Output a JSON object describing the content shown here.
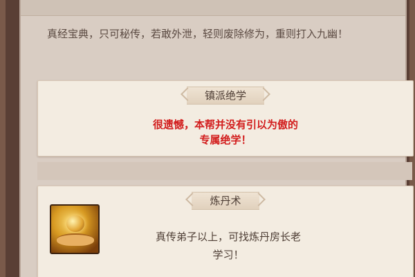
{
  "warning_text": "真经宝典，只可秘传，若敢外泄，轻则废除修为，重则打入九幽！",
  "cards": [
    {
      "title": "镇派绝学",
      "lines": [
        "很遗憾，本帮并没有引以为傲的",
        "专属绝学！"
      ],
      "text_color": "#d21c1c"
    },
    {
      "title": "炼丹术",
      "lines": [
        "真传弟子以上，可找炼丹房长老",
        "学习！"
      ],
      "icon": "alchemy-orb-icon",
      "text_color": "#4e3e35"
    }
  ],
  "colors": {
    "frame": "#5a3f35",
    "panel": "#d9cdc3",
    "card": "#f3ece1",
    "accent_red": "#d21c1c"
  }
}
